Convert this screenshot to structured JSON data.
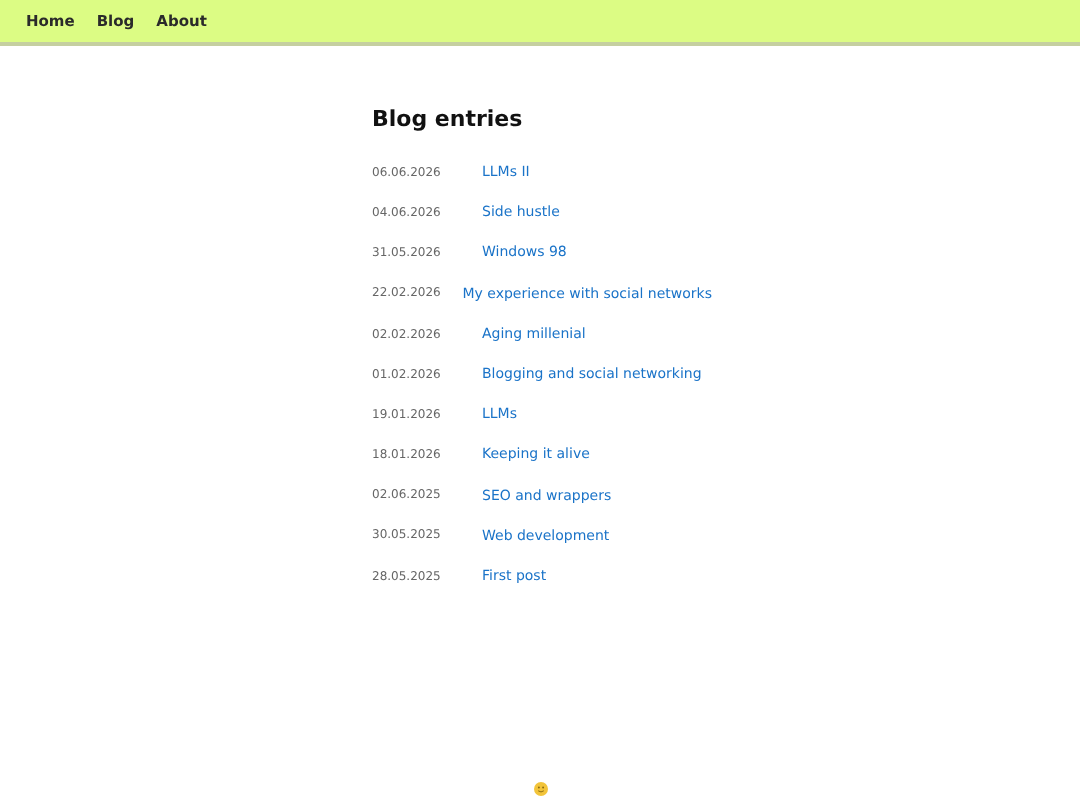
{
  "nav": {
    "links": [
      "Home",
      "Blog",
      "About"
    ]
  },
  "heading": "Blog entries",
  "entries": [
    {
      "date": "06.06.2026",
      "title": "LLMs II"
    },
    {
      "date": "04.06.2026",
      "title": "Side hustle"
    },
    {
      "date": "31.05.2026",
      "title": "Windows 98"
    },
    {
      "date": "22.02.2026",
      "title": "My experience with social networks"
    },
    {
      "date": "02.02.2026",
      "title": "Aging millenial"
    },
    {
      "date": "01.02.2026",
      "title": "Blogging and social networking"
    },
    {
      "date": "19.01.2026",
      "title": "LLMs"
    },
    {
      "date": "18.01.2026",
      "title": "Keeping it alive"
    },
    {
      "date": "02.06.2025",
      "title": "SEO and wrappers"
    },
    {
      "date": "30.05.2025",
      "title": "Web development"
    },
    {
      "date": "28.05.2025",
      "title": "First post"
    }
  ]
}
